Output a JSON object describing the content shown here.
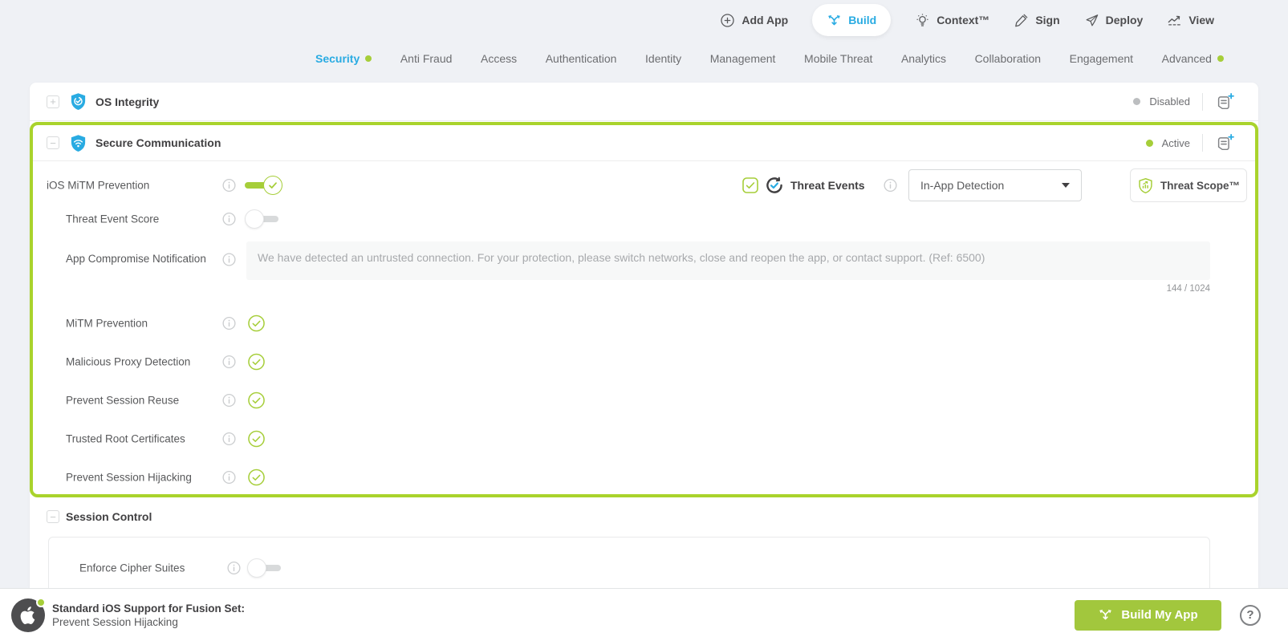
{
  "toolbar": {
    "add_app": "Add App",
    "build": "Build",
    "context": "Context™",
    "sign": "Sign",
    "deploy": "Deploy",
    "view": "View"
  },
  "nav": {
    "items": [
      {
        "label": "Security",
        "active": true,
        "dot": true
      },
      {
        "label": "Anti Fraud"
      },
      {
        "label": "Access"
      },
      {
        "label": "Authentication"
      },
      {
        "label": "Identity"
      },
      {
        "label": "Management"
      },
      {
        "label": "Mobile Threat"
      },
      {
        "label": "Analytics"
      },
      {
        "label": "Collaboration"
      },
      {
        "label": "Engagement"
      },
      {
        "label": "Advanced",
        "dot": true
      }
    ]
  },
  "os_integrity": {
    "title": "OS Integrity",
    "status": "Disabled"
  },
  "secure_communication": {
    "title": "Secure Communication",
    "status": "Active",
    "ios_mitm": {
      "label": "iOS MiTM Prevention",
      "enabled": true
    },
    "threat_events": {
      "label": "Threat Events",
      "checked": true,
      "mode": "In-App Detection"
    },
    "threat_scope": {
      "label": "Threat Scope™"
    },
    "threat_event_score": {
      "label": "Threat Event Score",
      "enabled": false
    },
    "app_compromise_notification": {
      "label": "App Compromise Notification",
      "message": "We have detected an untrusted connection. For your protection, please switch networks, close and reopen the app, or contact support. (Ref: 6500)",
      "char_count": "144 / 1024"
    },
    "checks": [
      {
        "label": "MiTM Prevention",
        "checked": true
      },
      {
        "label": "Malicious Proxy Detection",
        "checked": true
      },
      {
        "label": "Prevent Session Reuse",
        "checked": true
      },
      {
        "label": "Trusted Root Certificates",
        "checked": true
      },
      {
        "label": "Prevent Session Hijacking",
        "checked": true
      }
    ]
  },
  "session_control": {
    "title": "Session Control",
    "enforce_cipher_suites": {
      "label": "Enforce Cipher Suites",
      "enabled": false
    }
  },
  "footer": {
    "fusion_set_label": "Standard iOS Support for Fusion Set:",
    "fusion_set_value": "Prevent Session Hijacking",
    "build_button": "Build My App"
  },
  "icons": {
    "add-app": "plus-circle",
    "build": "fusion-merge-arrows",
    "context": "lightbulb",
    "sign": "pen",
    "deploy": "paper-plane",
    "view": "trend-chart",
    "os_integrity": "blue-shield-check",
    "secure_communication": "blue-shield-wifi",
    "threat_events": "circular-arrows-check",
    "threat_scope": "green-shield-chart",
    "add_note": "note-plus",
    "footer_logo": "apple-logo-circle",
    "help": "question-circle"
  },
  "colors": {
    "accent_green": "#a6ce39",
    "highlight_border": "#a9d32c",
    "brand_blue": "#29abe2",
    "status_disabled_dot": "#bcbec0",
    "build_button_bg": "#a2c73d",
    "page_bg": "#eff1f5"
  }
}
